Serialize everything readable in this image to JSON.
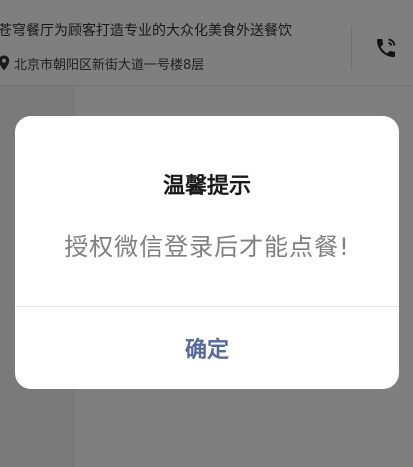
{
  "header": {
    "slogan": "苍穹餐厅为顾客打造专业的大众化美食外送餐饮",
    "address": "北京市朝阳区新街大道一号楼8层",
    "address_icon": "location-pin-icon",
    "phone_icon": "phone-icon"
  },
  "dialog": {
    "title": "温馨提示",
    "message": "授权微信登录后才能点餐!",
    "confirm_label": "确定"
  },
  "colors": {
    "confirm": "#57699a",
    "mask": "rgba(0,0,0,0.5)"
  }
}
